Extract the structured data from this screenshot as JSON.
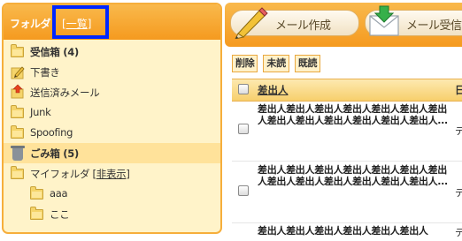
{
  "sidebar": {
    "title": "フォルダ",
    "list_link": "[一覧]",
    "list_link_text": "一覧",
    "items": [
      {
        "label": "受信箱 (4)",
        "icon": "folder-icon",
        "bold": true
      },
      {
        "label": "下書き",
        "icon": "pencil-icon",
        "bold": false
      },
      {
        "label": "送信済みメール",
        "icon": "sent-icon",
        "bold": false
      },
      {
        "label": "Junk",
        "icon": "folder-icon",
        "bold": false
      },
      {
        "label": "Spoofing",
        "icon": "folder-icon",
        "bold": false
      },
      {
        "label": "ごみ箱 (5)",
        "icon": "trash-icon",
        "bold": true,
        "selected": true
      },
      {
        "label": "マイフォルダ",
        "link": "非表示",
        "icon": "folder-icon",
        "bold": false
      },
      {
        "label": "aaa",
        "icon": "folder-icon",
        "bold": false
      },
      {
        "label": "ここ",
        "icon": "folder-icon",
        "bold": false
      }
    ]
  },
  "toolbar": {
    "compose_label": "メール作成",
    "receive_label": "メール受信"
  },
  "actions": {
    "delete": "削除",
    "unread": "未読",
    "read": "既読"
  },
  "table": {
    "sender_header": "差出人",
    "rows": [
      {
        "sender": "差出人差出人差出人差出人差出人差出人差出人差出人差出人差出人差出人差出人差出人...",
        "more": "デ"
      },
      {
        "sender": "差出人差出人差出人差出人差出人差出人差出人差出人差出人差出人差出人差出人差出人...",
        "more": "デ"
      },
      {
        "sender": "差出人差出人差出人差出人差出人差出人",
        "more": "デ"
      }
    ]
  },
  "colors": {
    "accent_orange": "#f6ae3b",
    "sidebar_bg": "#fff3c9",
    "highlight_box": "#0026ff",
    "selected_row": "#ffe29a"
  }
}
